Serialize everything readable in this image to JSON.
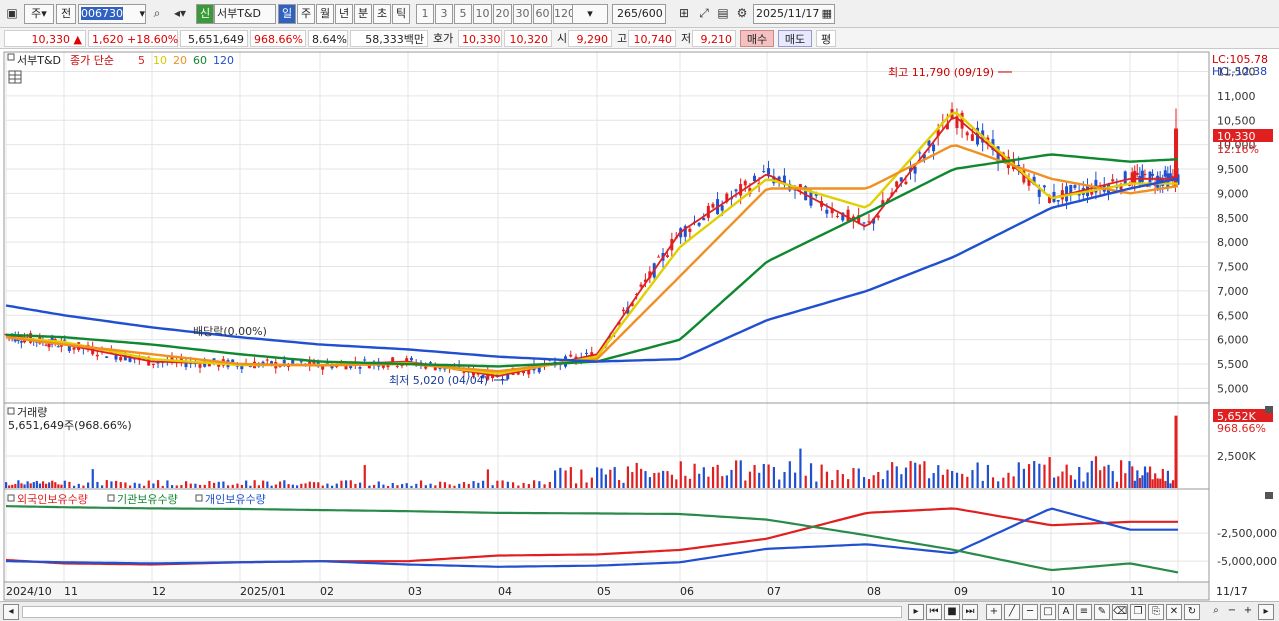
{
  "toolbar": {
    "period_label": "주",
    "prev_label": "전",
    "code": "006730",
    "name_badge": "신",
    "name": "서부T&D",
    "tabs": [
      "일",
      "주",
      "월",
      "년",
      "분",
      "초",
      "틱"
    ],
    "minute_opts": [
      "1",
      "3",
      "5",
      "10",
      "20",
      "30",
      "60",
      "120"
    ],
    "count_value": "265",
    "count_total": "/600",
    "date": "2025/11/17"
  },
  "quote": {
    "price": "10,330",
    "arrow": "▲",
    "change": "1,620",
    "change_pct": "+18.60%",
    "volume": "5,651,649",
    "vol_ratio": "968.66%",
    "turnover": "8.64%",
    "amount": "58,333",
    "amount_unit": "백만",
    "ask_label": "호가",
    "ask": "10,330",
    "bid": "10,320",
    "open_label": "시",
    "open": "9,290",
    "high_label": "고",
    "high": "10,740",
    "low_label": "저",
    "low": "9,210",
    "buy_label": "매수",
    "sell_label": "매도",
    "eval_label": "평"
  },
  "legend": {
    "name": "서부T&D",
    "indicator": "종가 단순",
    "ma": [
      "5",
      "10",
      "20",
      "60",
      "120"
    ],
    "ma_colors": [
      "#e02020",
      "#e0d000",
      "#f09020",
      "#108830",
      "#2050d0"
    ]
  },
  "annotations": {
    "high": "최고 11,790 (09/19)",
    "low": "최저 5,020 (04/04)",
    "dividend": "배당락(0.00%)",
    "lc": "LC:105.78",
    "hc": "HC:-12.38",
    "last_price": "10,330",
    "last_pct": "12.16%",
    "vol_tag": "5,652K",
    "vol_tag_pct": "968.66%"
  },
  "volume_panel": {
    "title": "거래량",
    "value": "5,651,649주(968.66%)"
  },
  "holdings_panel": {
    "series": [
      "외국인보유수량",
      "기관보유수량",
      "개인보유수량"
    ]
  },
  "chart_data": [
    {
      "type": "line",
      "title": "서부T&D",
      "x": [
        "2024/10",
        "11",
        "12",
        "2025/01",
        "02",
        "03",
        "04",
        "05",
        "06",
        "07",
        "08",
        "09",
        "10",
        "11",
        "11/17"
      ],
      "y_ticks": [
        "5,000",
        "5,500",
        "6,000",
        "6,500",
        "7,000",
        "7,500",
        "8,000",
        "8,500",
        "9,000",
        "9,500",
        "10,000",
        "10,500",
        "11,000",
        "11,500"
      ],
      "ylim": [
        4700,
        11900
      ],
      "series": [
        {
          "name": "5",
          "values": [
            6100,
            5900,
            5550,
            5500,
            5480,
            5550,
            5250,
            5700,
            8200,
            9400,
            8300,
            10600,
            8900,
            9300,
            9300
          ]
        },
        {
          "name": "10",
          "values": [
            6050,
            5950,
            5600,
            5480,
            5480,
            5520,
            5300,
            5650,
            7900,
            9300,
            8700,
            10700,
            8900,
            9200,
            9200
          ]
        },
        {
          "name": "20",
          "values": [
            6050,
            5900,
            5700,
            5500,
            5470,
            5500,
            5350,
            5600,
            7300,
            9100,
            9100,
            10000,
            9300,
            9000,
            9150
          ]
        },
        {
          "name": "60",
          "values": [
            6100,
            6050,
            5900,
            5700,
            5550,
            5500,
            5450,
            5550,
            6000,
            7600,
            8600,
            9500,
            9800,
            9650,
            9700
          ]
        },
        {
          "name": "120",
          "values": [
            6700,
            6500,
            6250,
            6050,
            5900,
            5800,
            5650,
            5550,
            5600,
            6400,
            7000,
            7700,
            8700,
            9100,
            9300
          ]
        }
      ]
    },
    {
      "type": "bar",
      "title": "거래량",
      "y_ticks": [
        "2,500K"
      ],
      "last_value": 5651649
    },
    {
      "type": "line",
      "y_ticks": [
        "-2,500,000",
        "-5,000,000"
      ],
      "series": [
        {
          "name": "외국인보유수량",
          "values": [
            -4900,
            -5200,
            -5300,
            -5100,
            -5000,
            -5000,
            -4500,
            -4400,
            -4000,
            -3000,
            -700,
            -300,
            -1800,
            -1500,
            -1500
          ]
        },
        {
          "name": "기관보유수량",
          "values": [
            -5000,
            -5100,
            -5200,
            -5100,
            -5000,
            -5300,
            -5500,
            -5400,
            -5100,
            -3900,
            -3500,
            -4300,
            -300,
            -2200,
            -2200
          ]
        },
        {
          "name": "개인보유수량",
          "values": [
            -100,
            -200,
            -300,
            -350,
            -450,
            -550,
            -700,
            -750,
            -800,
            -1300,
            -2700,
            -4000,
            -5800,
            -5200,
            -6000
          ]
        }
      ]
    }
  ]
}
